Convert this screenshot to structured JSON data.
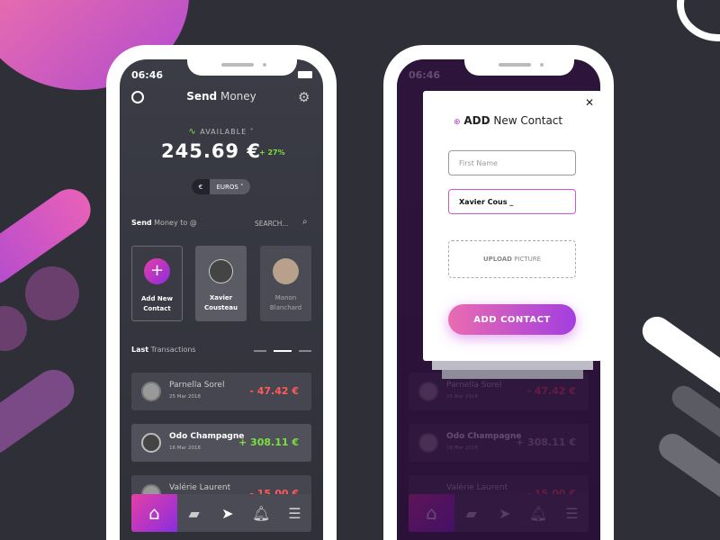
{
  "status": {
    "time": "06:46"
  },
  "header": {
    "title_bold": "Send",
    "title_rest": "Money"
  },
  "balance": {
    "label": "AVAILABLE",
    "amount": "245.69 €",
    "change": "+ 27%",
    "currency_symbol": "€",
    "currency": "EUROS"
  },
  "send": {
    "label_bold": "Send",
    "label_rest": "Money to @",
    "search_placeholder": "SEARCH..."
  },
  "contacts": [
    {
      "name": "Add New Contact"
    },
    {
      "name": "Xavier Cousteau"
    },
    {
      "name": "Manon Blanchard"
    }
  ],
  "transactions_header": {
    "bold": "Last",
    "rest": "Transactions"
  },
  "transactions": [
    {
      "name": "Parnella Sorel",
      "date": "25 Mar 2018",
      "amount": "- 47.42 €",
      "type": "debit"
    },
    {
      "name": "Odo Champagne",
      "date": "16 Mar 2018",
      "amount": "+ 308.11 €",
      "type": "credit"
    },
    {
      "name": "Valérie Laurent",
      "date": "",
      "amount": "- 15.00 €",
      "type": "debit"
    }
  ],
  "nav": [
    "home",
    "wallet",
    "send",
    "notifications",
    "menu"
  ],
  "modal": {
    "title_bold": "ADD",
    "title_rest": "New Contact",
    "first_name_placeholder": "First Name",
    "name_value": "Xavier Cous _",
    "upload_bold": "UPLOAD",
    "upload_rest": "PICTURE",
    "submit": "ADD CONTACT"
  },
  "colors": {
    "accent_pink": "#e63fa4",
    "accent_purple": "#8a2de0",
    "credit": "#7be03d",
    "debit": "#ff5a5a",
    "background": "#2e2f37"
  }
}
